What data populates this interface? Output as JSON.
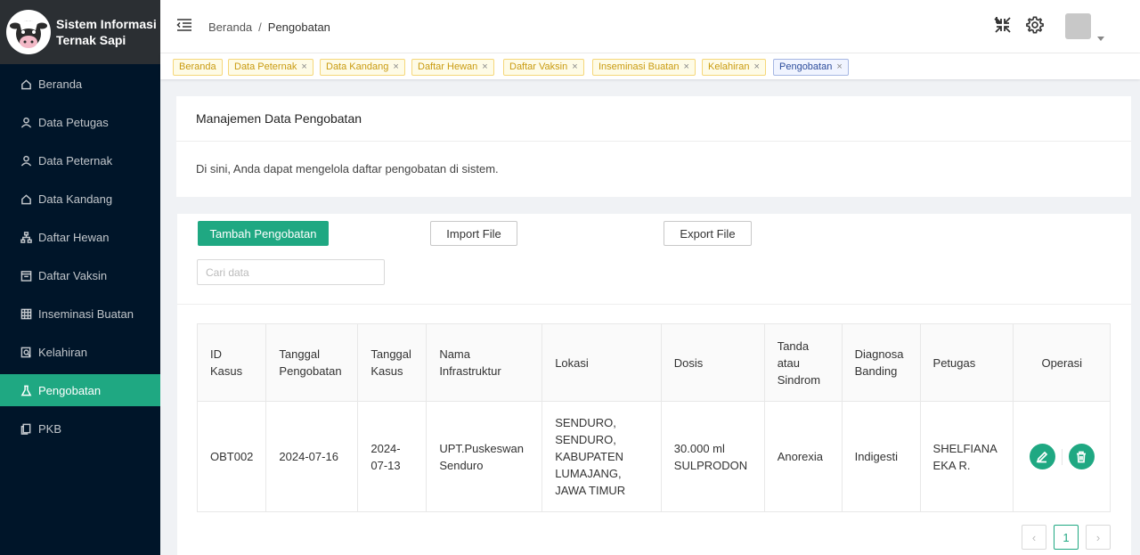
{
  "app": {
    "title_line1": "Sistem Informasi",
    "title_line2": "Ternak Sapi"
  },
  "sidebar": {
    "items": [
      {
        "label": "Beranda",
        "icon": "home-icon"
      },
      {
        "label": "Data Petugas",
        "icon": "user-icon"
      },
      {
        "label": "Data Peternak",
        "icon": "user-icon"
      },
      {
        "label": "Data Kandang",
        "icon": "home-icon"
      },
      {
        "label": "Daftar Hewan",
        "icon": "hierarchy-icon"
      },
      {
        "label": "Daftar Vaksin",
        "icon": "calendar-icon"
      },
      {
        "label": "Inseminasi Buatan",
        "icon": "grid-icon"
      },
      {
        "label": "Kelahiran",
        "icon": "search-doc-icon"
      },
      {
        "label": "Pengobatan",
        "icon": "flask-icon",
        "active": true
      },
      {
        "label": "PKB",
        "icon": "copy-icon"
      }
    ]
  },
  "header": {
    "breadcrumb_home": "Beranda",
    "breadcrumb_sep": "/",
    "breadcrumb_current": "Pengobatan"
  },
  "tags": [
    {
      "label": "Beranda",
      "closable": false
    },
    {
      "label": "Data Peternak",
      "closable": true
    },
    {
      "label": "Data Kandang",
      "closable": true
    },
    {
      "label": "Daftar Hewan",
      "closable": true
    },
    {
      "label": "Daftar Vaksin",
      "closable": true
    },
    {
      "label": "Inseminasi Buatan",
      "closable": true
    },
    {
      "label": "Kelahiran",
      "closable": true
    },
    {
      "label": "Pengobatan",
      "closable": true,
      "active": true
    }
  ],
  "tag_close": "×",
  "intro": {
    "title": "Manajemen Data Pengobatan",
    "description": "Di sini, Anda dapat mengelola daftar pengobatan di sistem."
  },
  "toolbar": {
    "add_label": "Tambah Pengobatan",
    "import_label": "Import File",
    "export_label": "Export File",
    "search_placeholder": "Cari data"
  },
  "table": {
    "headers": [
      "ID Kasus",
      "Tanggal Pengobatan",
      "Tanggal Kasus",
      "Nama Infrastruktur",
      "Lokasi",
      "Dosis",
      "Tanda atau Sindrom",
      "Diagnosa Banding",
      "Petugas",
      "Operasi"
    ],
    "rows": [
      [
        "OBT002",
        "2024-07-16",
        "2024-07-13",
        "UPT.Puskeswan Senduro",
        "SENDURO, SENDURO, KABUPATEN LUMAJANG, JAWA TIMUR",
        "30.000 ml SULPRODON",
        "Anorexia",
        "Indigesti",
        "SHELFIANA EKA R."
      ]
    ]
  },
  "pagination": {
    "prev": "‹",
    "current": "1",
    "next": "›"
  },
  "colors": {
    "accent": "#1fa882",
    "sidebar_bg": "#001529",
    "brand_bg": "#2b2f33"
  }
}
